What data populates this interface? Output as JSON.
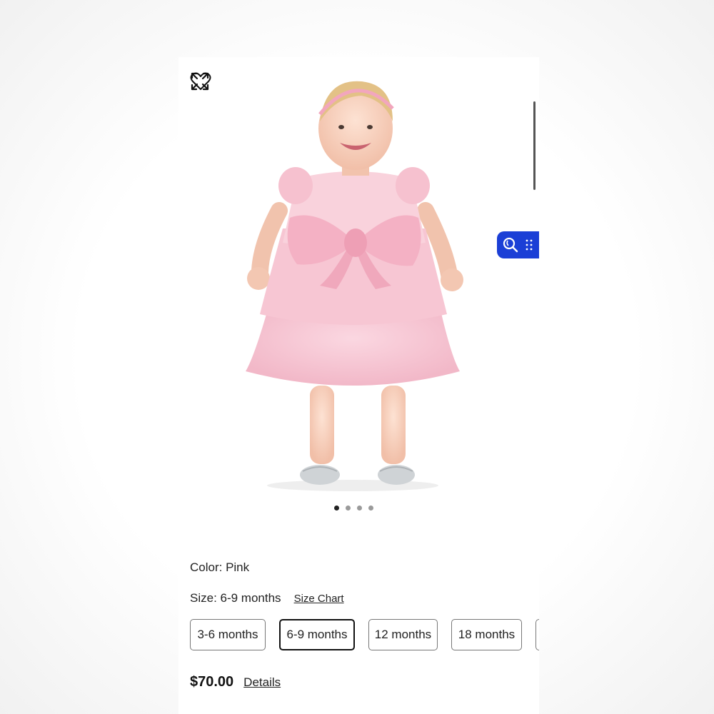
{
  "product": {
    "color_label": "Color: Pink",
    "size_label": "Size: 6-9 months",
    "size_chart_link": "Size Chart",
    "sizes": [
      "3-6 months",
      "6-9 months",
      "12 months",
      "18 months"
    ],
    "selected_size": "6-9 months",
    "price": "$70.00",
    "details_link": "Details"
  },
  "gallery": {
    "image_count": 4,
    "active_index": 0
  },
  "icons": {
    "favorite": "heart-icon",
    "expand": "expand-icon",
    "visual_search": "visual-search-icon",
    "drag_handle": "drag-handle-icon"
  },
  "colors": {
    "accent_tab": "#1b3fd6",
    "dress": "#f5c4d2"
  }
}
